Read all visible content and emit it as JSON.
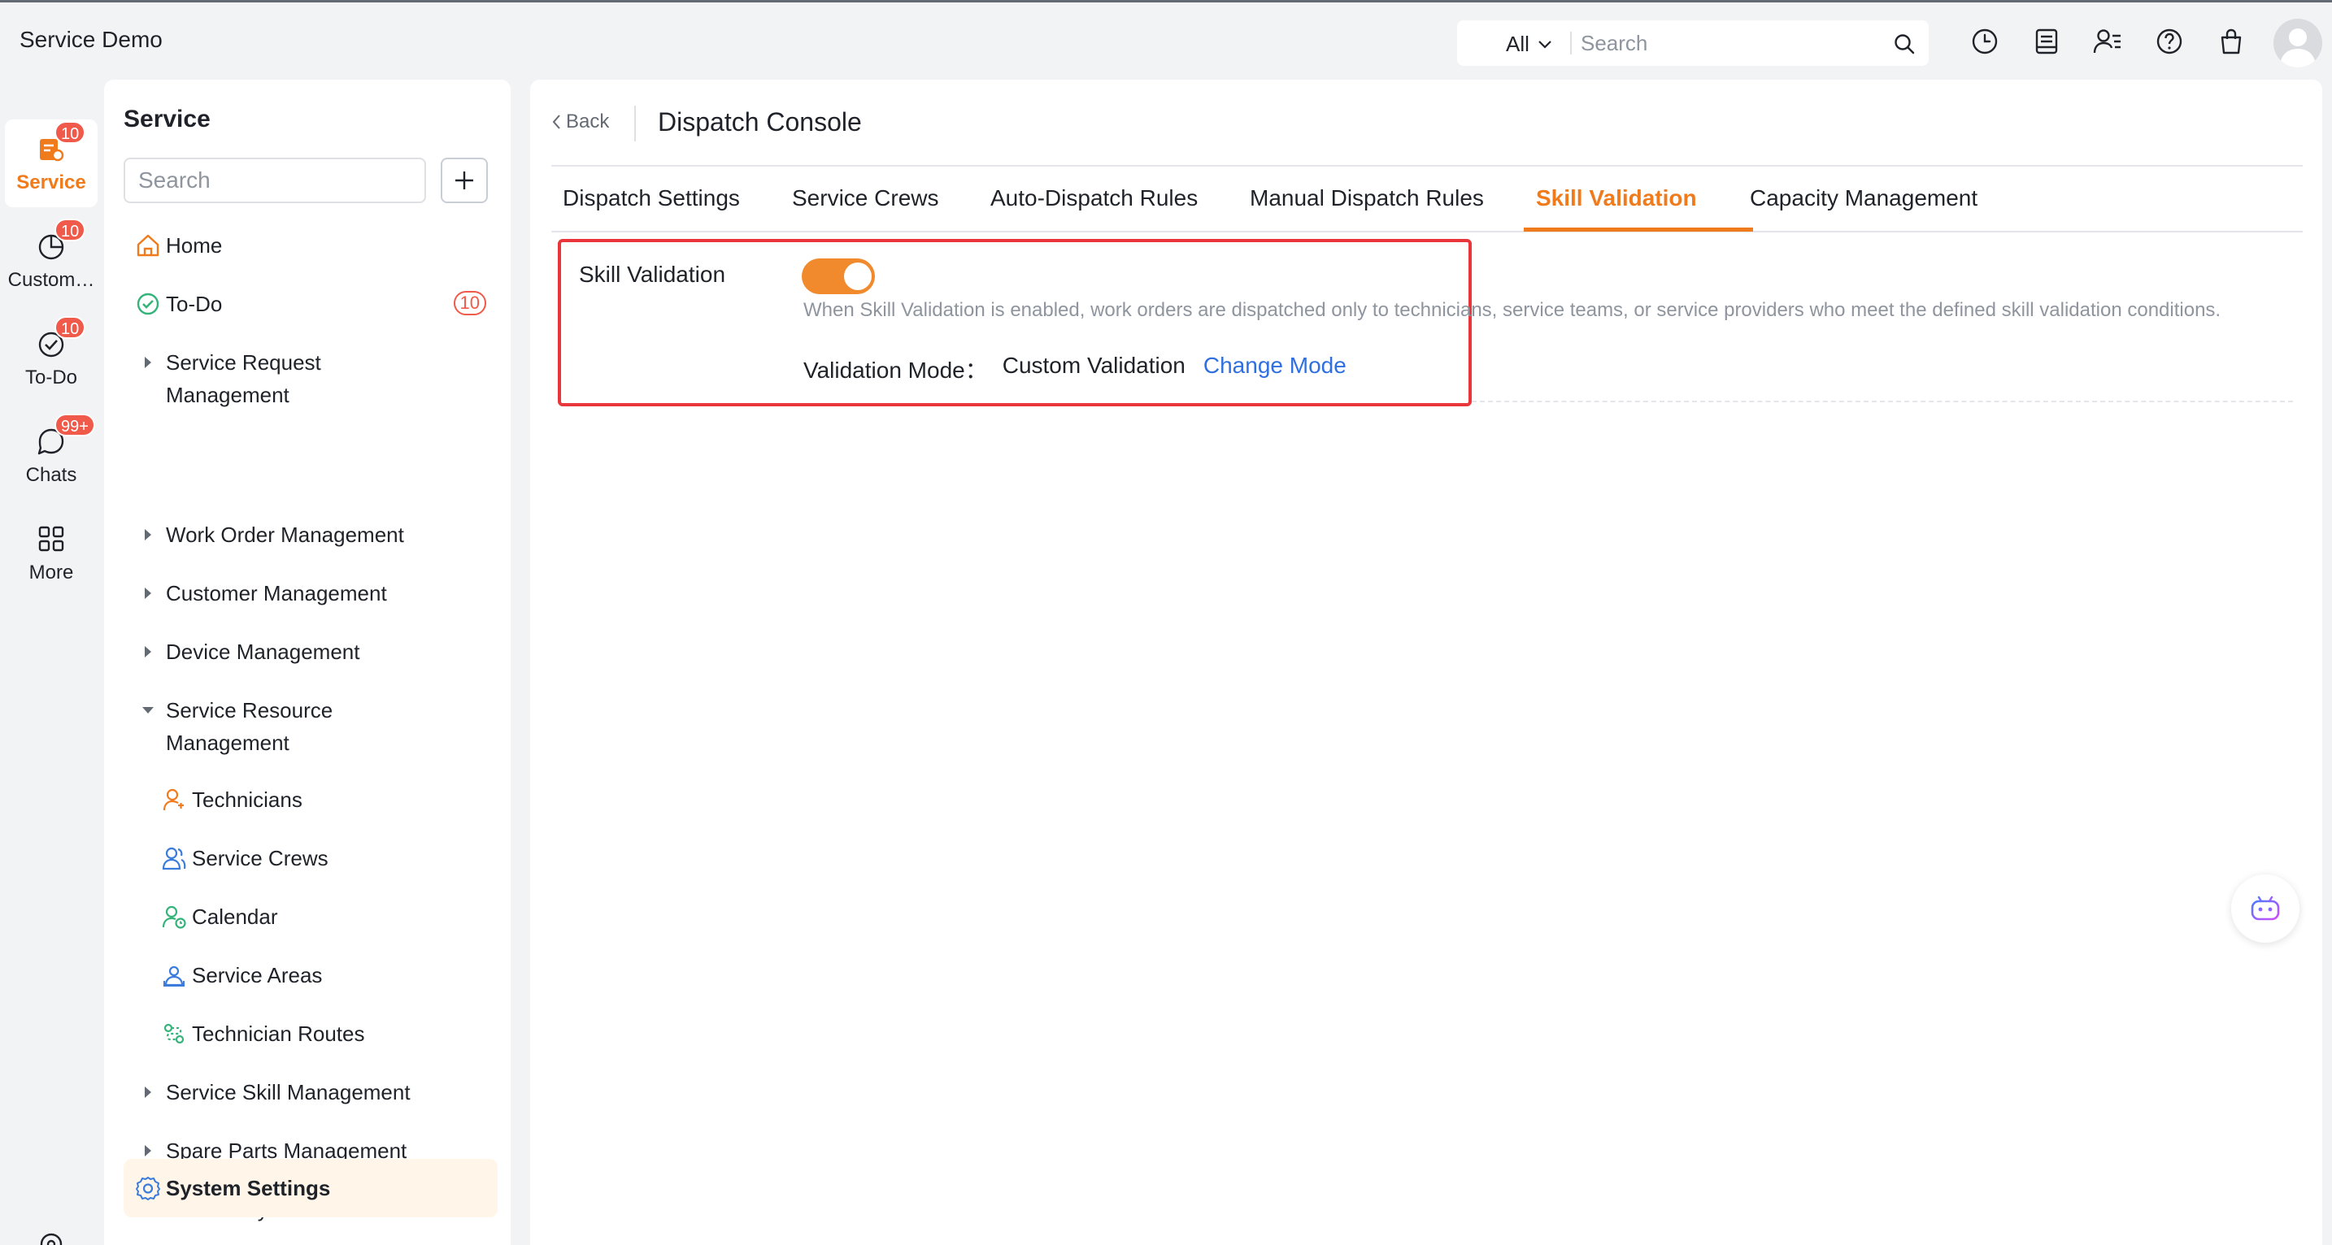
{
  "app": {
    "title": "Service Demo"
  },
  "topbar": {
    "search_scope": "All",
    "search_placeholder": "Search",
    "icons": [
      "clock-icon",
      "notes-icon",
      "contacts-icon",
      "help-icon",
      "bag-icon"
    ]
  },
  "rail": {
    "items": [
      {
        "label": "Service",
        "badge": "10",
        "active": true,
        "icon": "service-icon"
      },
      {
        "label": "Custom…",
        "badge": "10",
        "active": false,
        "icon": "pie-chart-icon"
      },
      {
        "label": "To-Do",
        "badge": "10",
        "active": false,
        "icon": "check-circle-icon"
      },
      {
        "label": "Chats",
        "badge": "99+",
        "active": false,
        "icon": "chat-bubble-icon"
      },
      {
        "label": "More",
        "badge": "",
        "active": false,
        "icon": "grid-icon"
      }
    ]
  },
  "sidebar": {
    "title": "Service",
    "search_placeholder": "Search",
    "items": [
      {
        "label": "Home",
        "type": "icon",
        "icon": "home-icon"
      },
      {
        "label": "To-Do",
        "type": "icon",
        "icon": "check-circle-icon",
        "badge": "10"
      },
      {
        "label": "Service Request Management",
        "type": "collapsed"
      },
      {
        "label": "Work Order Management",
        "type": "collapsed"
      },
      {
        "label": "Customer Management",
        "type": "collapsed"
      },
      {
        "label": "Device Management",
        "type": "collapsed"
      },
      {
        "label": "Service Resource Management",
        "type": "expanded"
      },
      {
        "label": "Technicians",
        "type": "sub",
        "icon": "technician-icon"
      },
      {
        "label": "Service Crews",
        "type": "sub",
        "icon": "crew-icon"
      },
      {
        "label": "Calendar",
        "type": "sub",
        "icon": "calendar-user-icon"
      },
      {
        "label": "Service Areas",
        "type": "sub",
        "icon": "area-icon"
      },
      {
        "label": "Technician Routes",
        "type": "sub",
        "icon": "route-icon"
      },
      {
        "label": "Service Skill Management",
        "type": "collapsed"
      },
      {
        "label": "Spare Parts Management",
        "type": "collapsed"
      },
      {
        "label": "Data Analysis",
        "type": "collapsed"
      },
      {
        "label": "System Settings",
        "type": "selected",
        "icon": "gear-icon"
      }
    ]
  },
  "main": {
    "back_label": "Back",
    "page_title": "Dispatch Console",
    "tabs": [
      {
        "label": "Dispatch Settings",
        "active": false
      },
      {
        "label": "Service Crews",
        "active": false
      },
      {
        "label": "Auto-Dispatch Rules",
        "active": false
      },
      {
        "label": "Manual Dispatch Rules",
        "active": false
      },
      {
        "label": "Skill Validation",
        "active": true
      },
      {
        "label": "Capacity Management",
        "active": false
      }
    ],
    "skill_validation": {
      "label": "Skill Validation",
      "enabled": true,
      "description": "When Skill Validation is enabled, work orders are dispatched only to technicians, service teams, or service providers who meet the defined skill validation conditions.",
      "mode_label": "Validation Mode：",
      "mode_value": "Custom Validation",
      "change_mode_label": "Change Mode"
    }
  },
  "colors": {
    "accent": "#f07b1c",
    "link": "#2f6fdf",
    "badge": "#f05a4a",
    "highlight": "#e8363a"
  }
}
